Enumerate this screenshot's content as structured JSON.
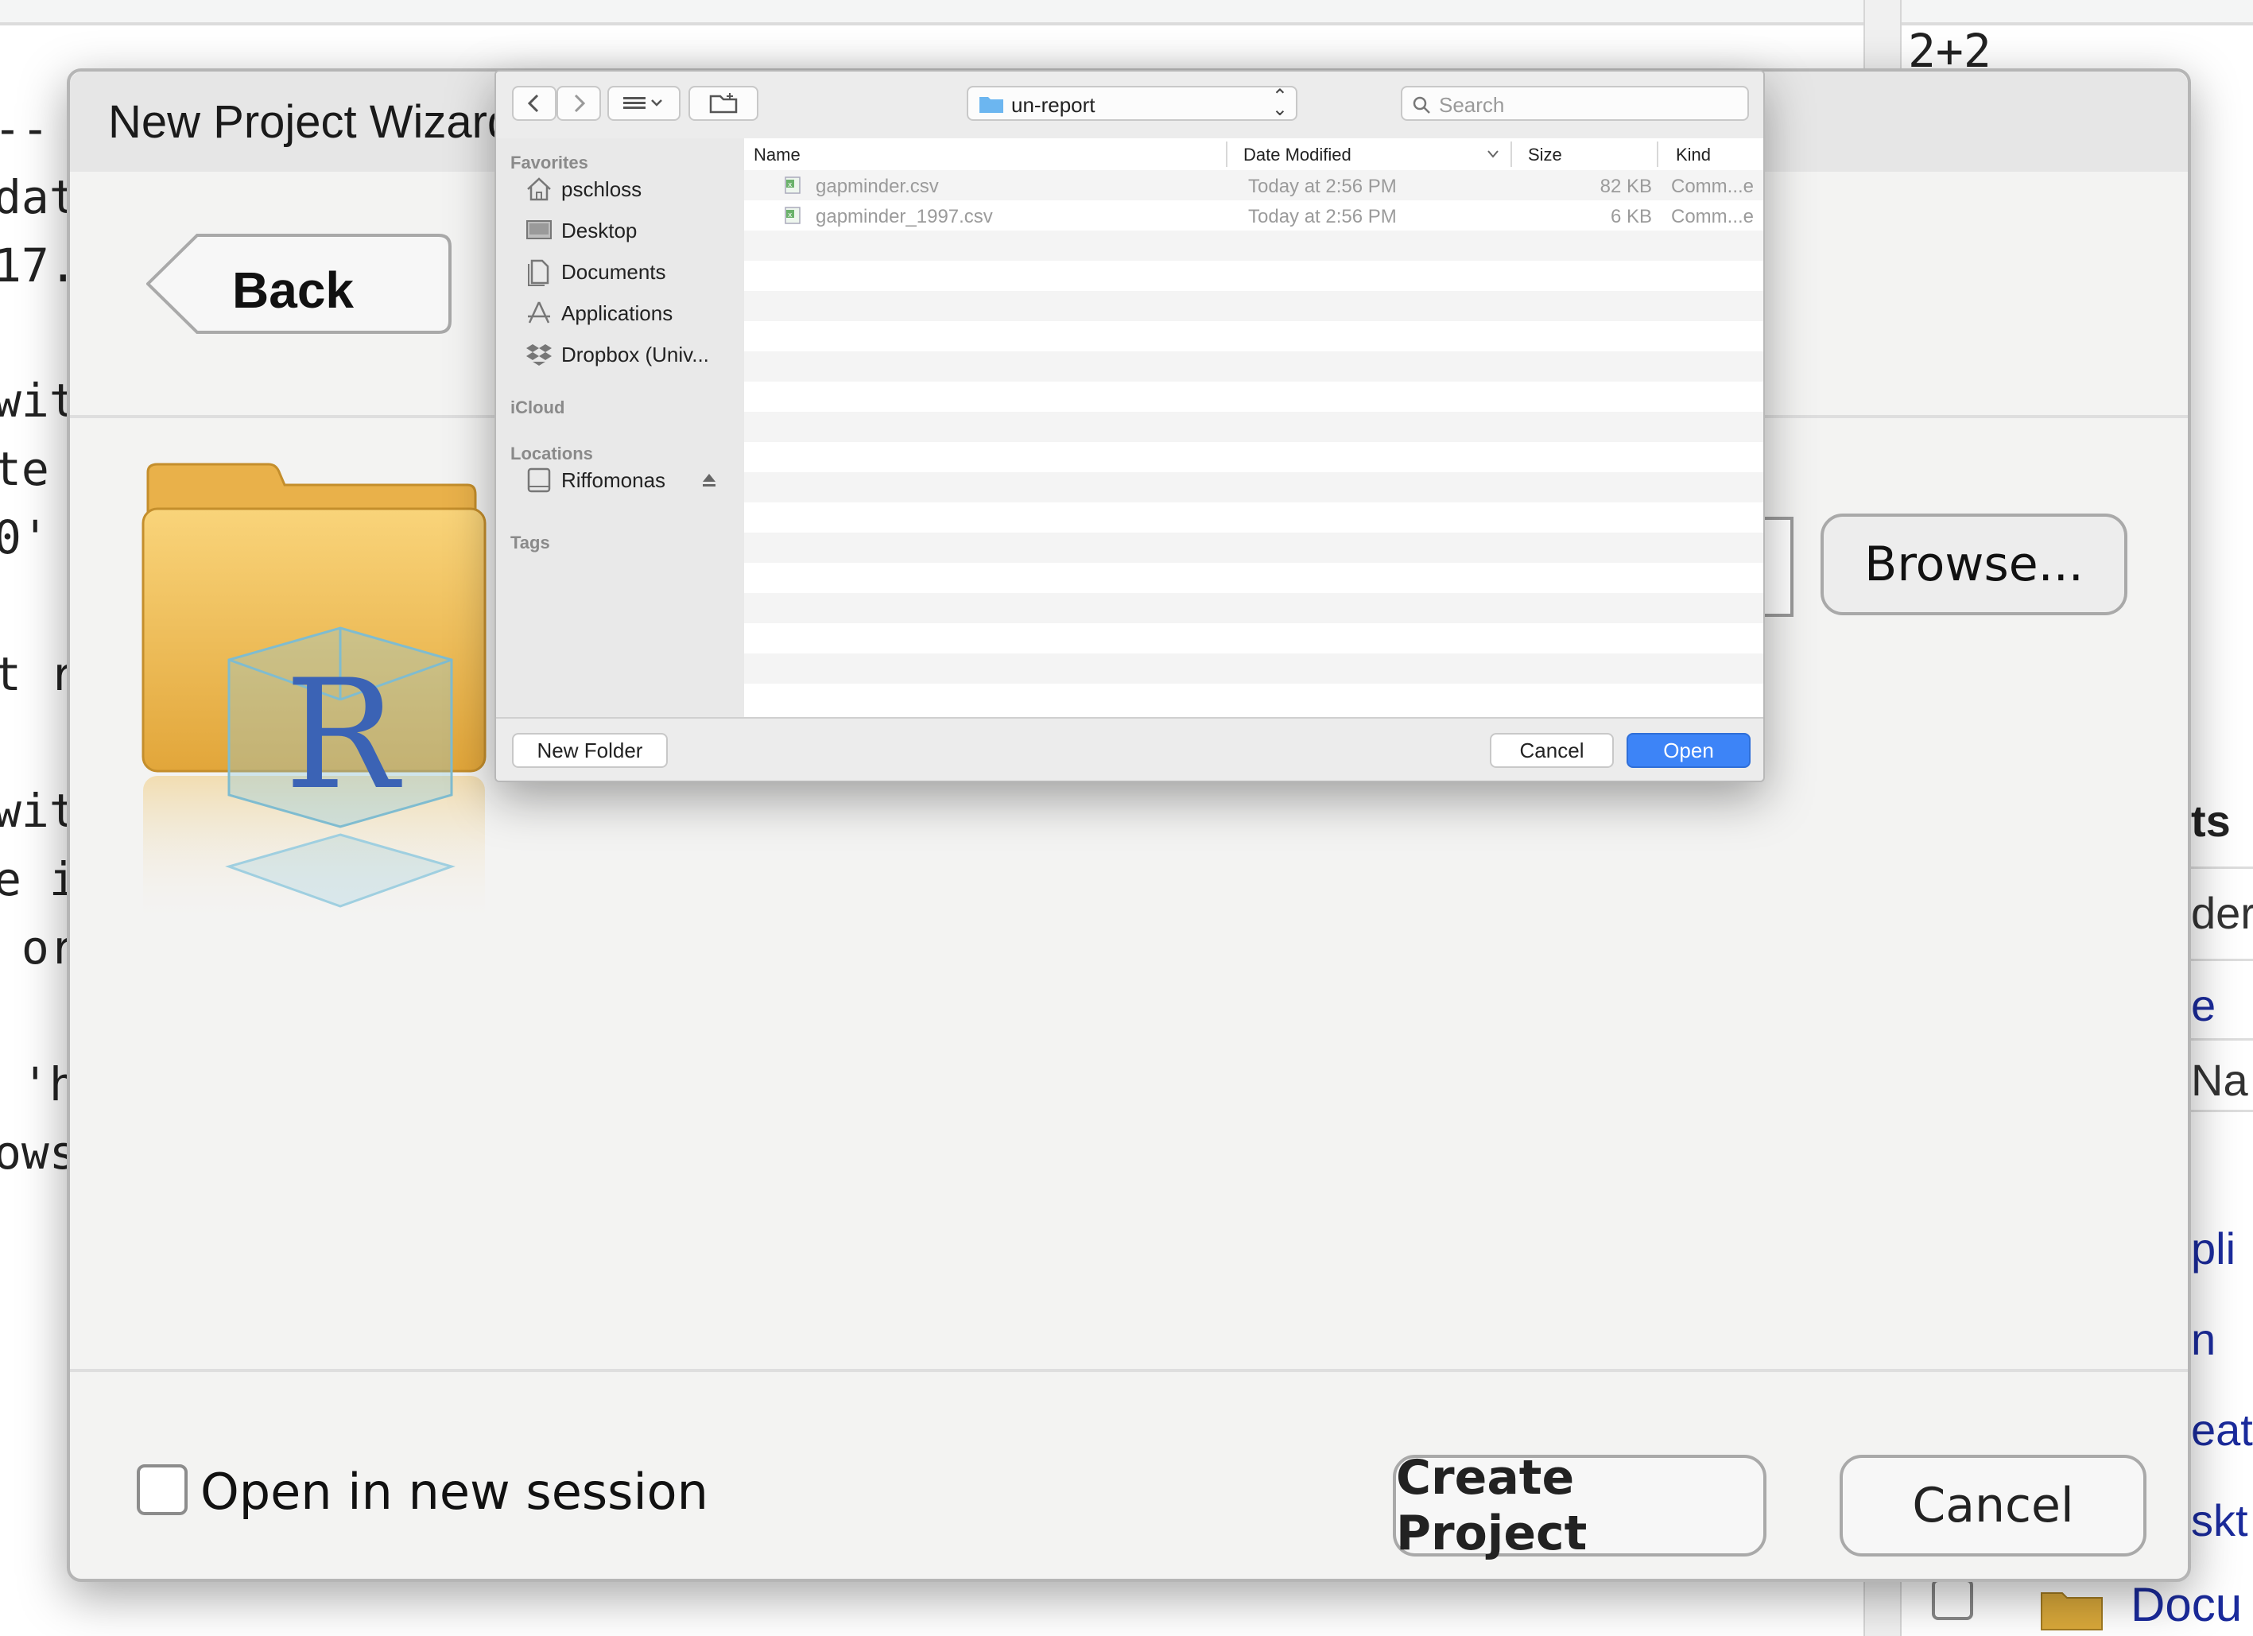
{
  "background": {
    "code_lines": [
      "--",
      "dat",
      "17.",
      "wit",
      "te",
      "0'",
      "t r",
      "wit",
      "e i",
      " or",
      " 'h",
      "ows"
    ],
    "console_text": "2+2",
    "right_panel": [
      "ts",
      "der",
      "e",
      "Na",
      "pli",
      "n",
      "eat",
      "skt"
    ],
    "files_item": "Docu"
  },
  "wizard": {
    "title": "New Project Wizard",
    "back_label": "Back",
    "browse_label": "Browse...",
    "open_new_session_label": "Open in new session",
    "open_new_session_checked": false,
    "create_project_label": "Create Project",
    "cancel_label": "Cancel"
  },
  "finder": {
    "location": "un-report",
    "search_placeholder": "Search",
    "sidebar": {
      "favorites_header": "Favorites",
      "favorites": [
        {
          "label": "pschloss",
          "icon": "home-icon"
        },
        {
          "label": "Desktop",
          "icon": "desktop-icon"
        },
        {
          "label": "Documents",
          "icon": "documents-icon"
        },
        {
          "label": "Applications",
          "icon": "applications-icon"
        },
        {
          "label": "Dropbox (Univ...",
          "icon": "dropbox-icon"
        }
      ],
      "icloud_header": "iCloud",
      "locations_header": "Locations",
      "locations": [
        {
          "label": "Riffomonas",
          "icon": "disk-icon"
        }
      ],
      "tags_header": "Tags"
    },
    "columns": {
      "name": "Name",
      "date_modified": "Date Modified",
      "size": "Size",
      "kind": "Kind"
    },
    "files": [
      {
        "name": "gapminder.csv",
        "date": "Today at 2:56 PM",
        "size": "82 KB",
        "kind": "Comm...e"
      },
      {
        "name": "gapminder_1997.csv",
        "date": "Today at 2:56 PM",
        "size": "6 KB",
        "kind": "Comm...e"
      }
    ],
    "new_folder_label": "New Folder",
    "cancel_label": "Cancel",
    "open_label": "Open",
    "colors": {
      "accent": "#3d84f7"
    }
  }
}
